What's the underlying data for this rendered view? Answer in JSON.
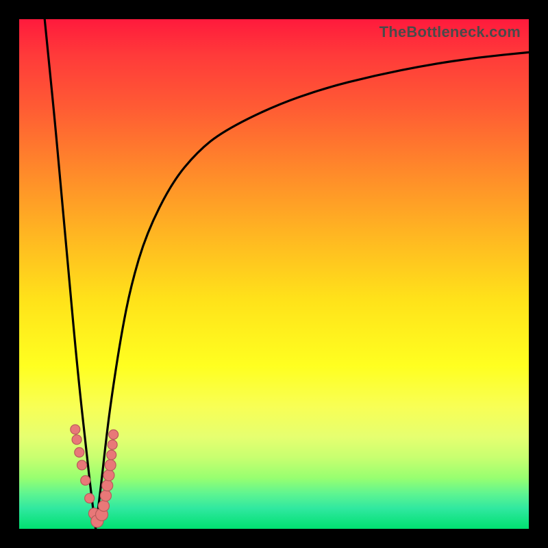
{
  "watermark": "TheBottleneck.com",
  "colors": {
    "frame": "#000000",
    "curve": "#000000",
    "dot_fill": "#e87878",
    "dot_stroke": "#b85a5a",
    "gradient_top": "#ff1a3c",
    "gradient_bottom": "#00e070"
  },
  "chart_data": {
    "type": "line",
    "title": "",
    "xlabel": "",
    "ylabel": "",
    "xlim": [
      0,
      100
    ],
    "ylim": [
      0,
      100
    ],
    "grid": false,
    "legend": false,
    "notes": "Bottleneck-style V curve. Y = bottleneck % (0 at valley, 100 at top). X = relative component score. Minimum near x≈15.",
    "series": [
      {
        "name": "left-branch",
        "x": [
          5,
          6,
          7,
          8,
          9,
          10,
          11,
          12,
          13,
          14,
          15
        ],
        "y": [
          100,
          90,
          80,
          69,
          58,
          47,
          36,
          26,
          17,
          8,
          0
        ]
      },
      {
        "name": "right-branch",
        "x": [
          15,
          16,
          17,
          18,
          20,
          22,
          25,
          30,
          35,
          40,
          50,
          60,
          70,
          80,
          90,
          100
        ],
        "y": [
          0,
          8,
          17,
          25,
          38,
          48,
          58,
          68,
          74,
          78,
          83,
          86.5,
          89,
          91,
          92.5,
          93.5
        ]
      }
    ],
    "markers": {
      "name": "highlight-dots",
      "x": [
        11.0,
        11.3,
        11.8,
        12.3,
        13.0,
        13.8,
        14.7,
        15.3,
        16.2,
        16.6,
        17.0,
        17.3,
        17.6,
        17.9,
        18.1,
        18.3,
        18.5
      ],
      "y": [
        19.5,
        17.5,
        15.0,
        12.5,
        9.5,
        6.0,
        3.0,
        1.5,
        2.8,
        4.5,
        6.5,
        8.5,
        10.5,
        12.5,
        14.5,
        16.5,
        18.5
      ],
      "r": [
        7,
        7,
        7,
        7,
        7,
        7,
        8,
        9,
        9,
        8,
        8,
        8,
        8,
        8,
        7,
        7,
        7
      ]
    }
  }
}
